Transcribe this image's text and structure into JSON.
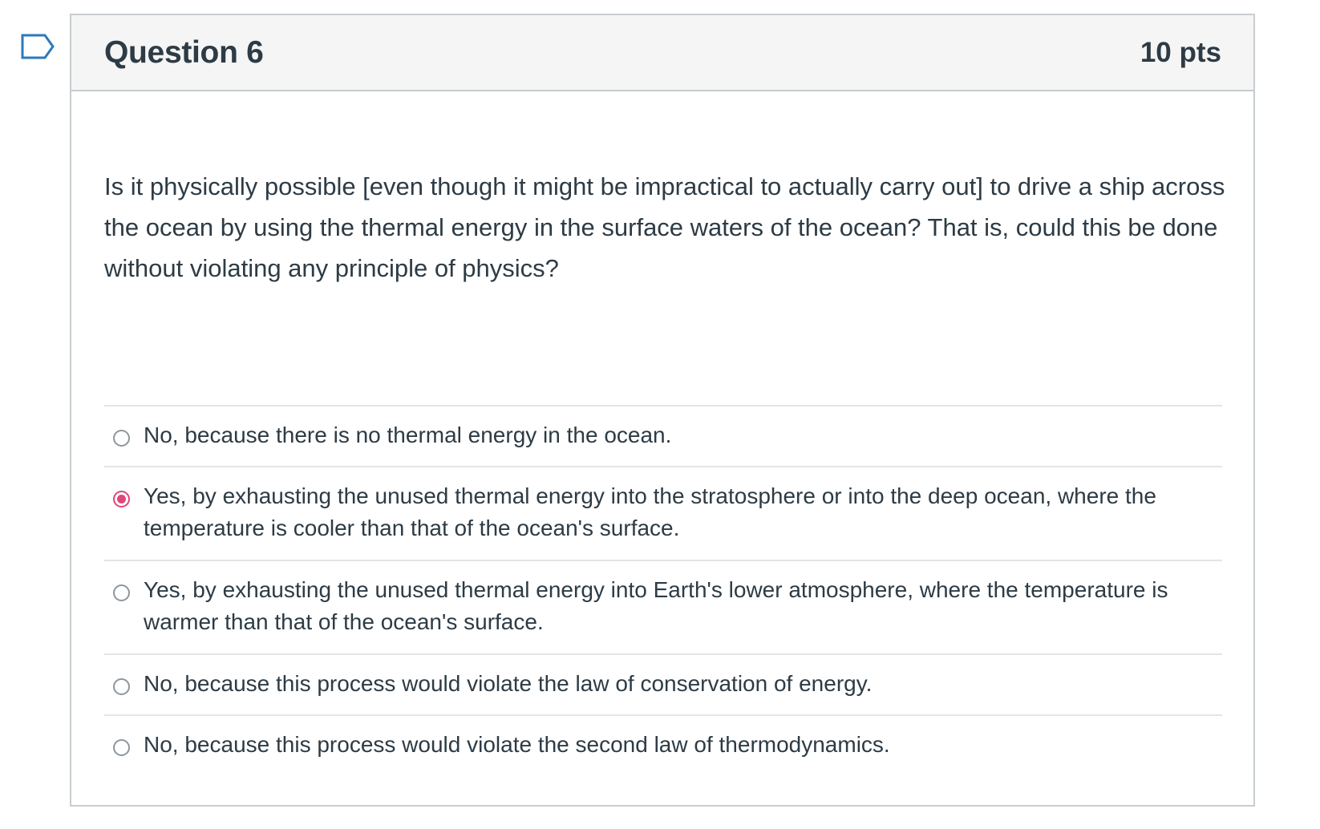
{
  "icons": {
    "flag": "flag-icon",
    "radio": "radio-button"
  },
  "colors": {
    "accent": "#e0457b",
    "text": "#2d3b45",
    "header_bg": "#f5f5f5",
    "border": "#c7cdd1"
  },
  "question": {
    "title": "Question 6",
    "points": "10 pts",
    "text": "Is it physically possible [even though it might be impractical to actually carry out] to drive a ship across the ocean by using the thermal energy in the surface waters of the ocean? That is, could this be done without violating any principle of physics?",
    "selected_index": 1,
    "answers": [
      {
        "label": "No, because there is no thermal energy in the ocean."
      },
      {
        "label": "Yes, by exhausting the unused thermal energy into the stratosphere or into the deep ocean, where the temperature is cooler than that of the ocean's surface."
      },
      {
        "label": "Yes, by exhausting the unused thermal energy into Earth's lower atmosphere, where the temperature is warmer than that of the ocean's surface."
      },
      {
        "label": "No, because this process would violate the law of conservation of energy."
      },
      {
        "label": "No, because this process would violate the second law of thermodynamics."
      }
    ]
  }
}
